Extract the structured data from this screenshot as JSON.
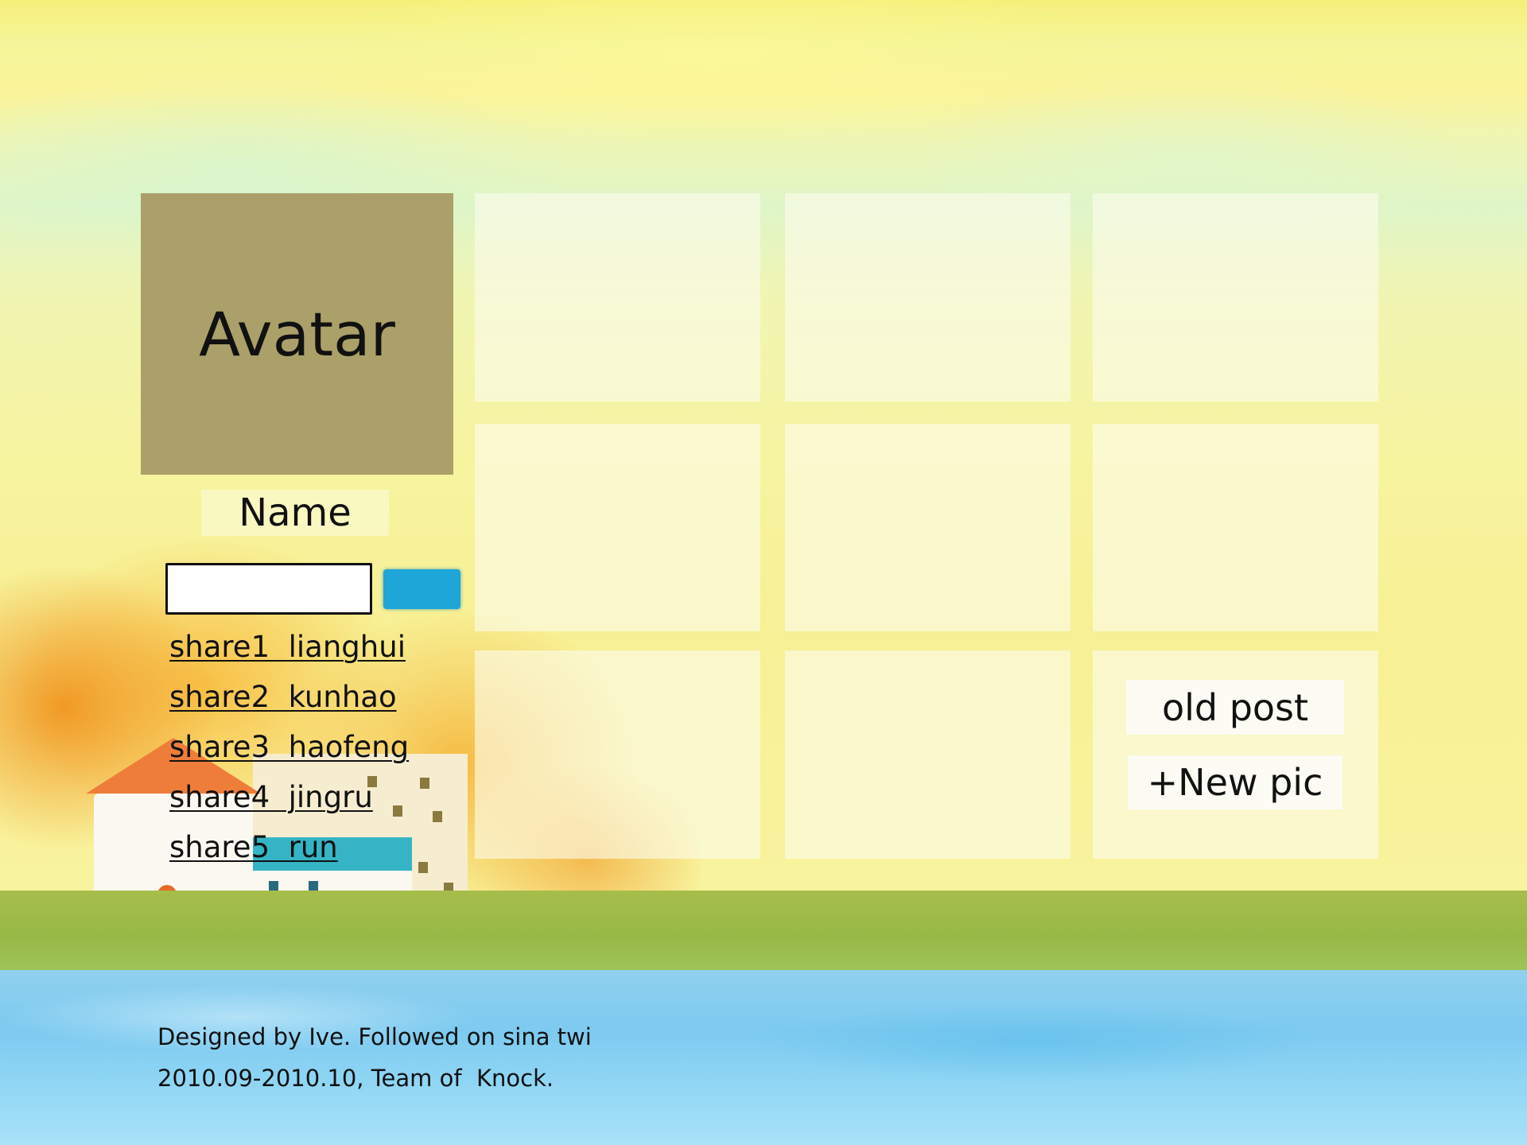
{
  "profile": {
    "avatar_label": "Avatar",
    "name_label": "Name"
  },
  "search": {
    "value": "",
    "placeholder": ""
  },
  "shares": [
    {
      "label": "share1  lianghui"
    },
    {
      "label": "share2  kunhao"
    },
    {
      "label": "share3  haofeng"
    },
    {
      "label": "share4  jingru"
    },
    {
      "label": "share5  run"
    }
  ],
  "actions": {
    "old_post": "old post",
    "new_pic": "+New pic"
  },
  "footer": {
    "line1": "Designed by Ive. Followed on sina twi",
    "line2": "2010.09-2010.10, Team of  Knock."
  },
  "colors": {
    "avatar_bg": "#aba069",
    "search_button": "#1ea6d8",
    "tile_bg": "rgba(252,252,235,0.62)"
  }
}
